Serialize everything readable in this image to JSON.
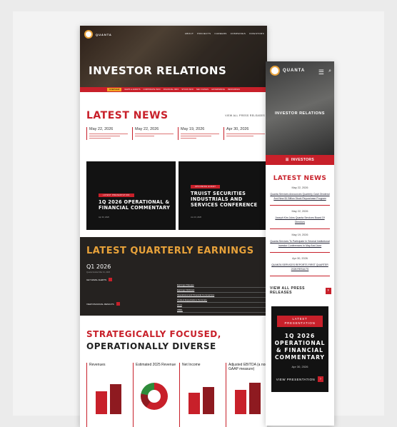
{
  "brand": {
    "name": "QUANTA"
  },
  "desktop": {
    "top_nav": [
      "ABOUT",
      "PROJECTS",
      "CAREERS",
      "COMPANIES",
      "INVESTORS"
    ],
    "hero_title": "INVESTOR RELATIONS",
    "sub_nav": [
      "OVERVIEW",
      "NEWS & EVENTS",
      "CORPORATE INFO",
      "FINANCIAL INFO",
      "STOCK INFO",
      "SEC FILINGS",
      "GOVERNANCE",
      "RESOURCES"
    ],
    "news_title": "LATEST NEWS",
    "view_all": "VIEW ALL PRESS RELEASES",
    "news_dates": [
      "May 22, 2026",
      "May 22, 2026",
      "May 19, 2026",
      "Apr 30, 2026"
    ],
    "card1": {
      "tag": "LATEST PRESENTATION",
      "title": "1Q 2026 OPERATIONAL & FINANCIAL COMMENTARY",
      "date": "Apr 30, 2026"
    },
    "card2": {
      "tag": "UPCOMING EVENT",
      "title": "TRUIST SECURITIES INDUSTRIALS AND SERVICES CONFERENCE",
      "date": "Jun 10, 2026"
    },
    "earnings_title": "LATEST QUARTERLY EARNINGS",
    "quarter": "Q1 2026",
    "quarter_sub": "Quarter Ended Mar 31, 2026",
    "get_email": "GET EMAIL ALERTS",
    "view_fin": "VIEW FINANCIAL RESULTS",
    "docs": [
      "Earnings Release",
      "Earnings Webcast",
      "Operational and Financial Commentary",
      "Outlook Expectations Summary",
      "10-Q",
      "XBRL"
    ],
    "strategy_line1": "STRATEGICALLY FOCUSED,",
    "strategy_line2": "OPERATIONALLY DIVERSE",
    "charts": [
      "Revenues",
      "Estimated 2025 Revenue",
      "Net Income",
      "Adjusted EBITDA (a non-GAAP measure)"
    ]
  },
  "mobile": {
    "hero_title": "INVESTOR RELATIONS",
    "bar_label": "INVESTORS",
    "news_title": "LATEST NEWS",
    "items": [
      {
        "date": "May 22, 2026",
        "link": "Quanta Services Announces Quarterly Cash Dividend And New $1 Billion Stock Repurchase Program"
      },
      {
        "date": "May 22, 2026",
        "link": "Joseph Kim Joins Quanta Services Board Of Directors"
      },
      {
        "date": "May 19, 2026",
        "link": "Quanta Services To Participate In Several Institutional Investor Conferences In May And June"
      },
      {
        "date": "Apr 30, 2026",
        "link": "QUANTA SERVICES REPORTS FIRST QUARTER 2026 RESULTS"
      }
    ],
    "view_all": "VIEW ALL PRESS RELEASES",
    "pres_tag": "LATEST PRESENTATION",
    "pres_title": "1Q 2026 OPERATIONAL & FINANCIAL COMMENTARY",
    "pres_date": "Apr 30, 2026",
    "view_pres": "VIEW PRESENTATION"
  }
}
